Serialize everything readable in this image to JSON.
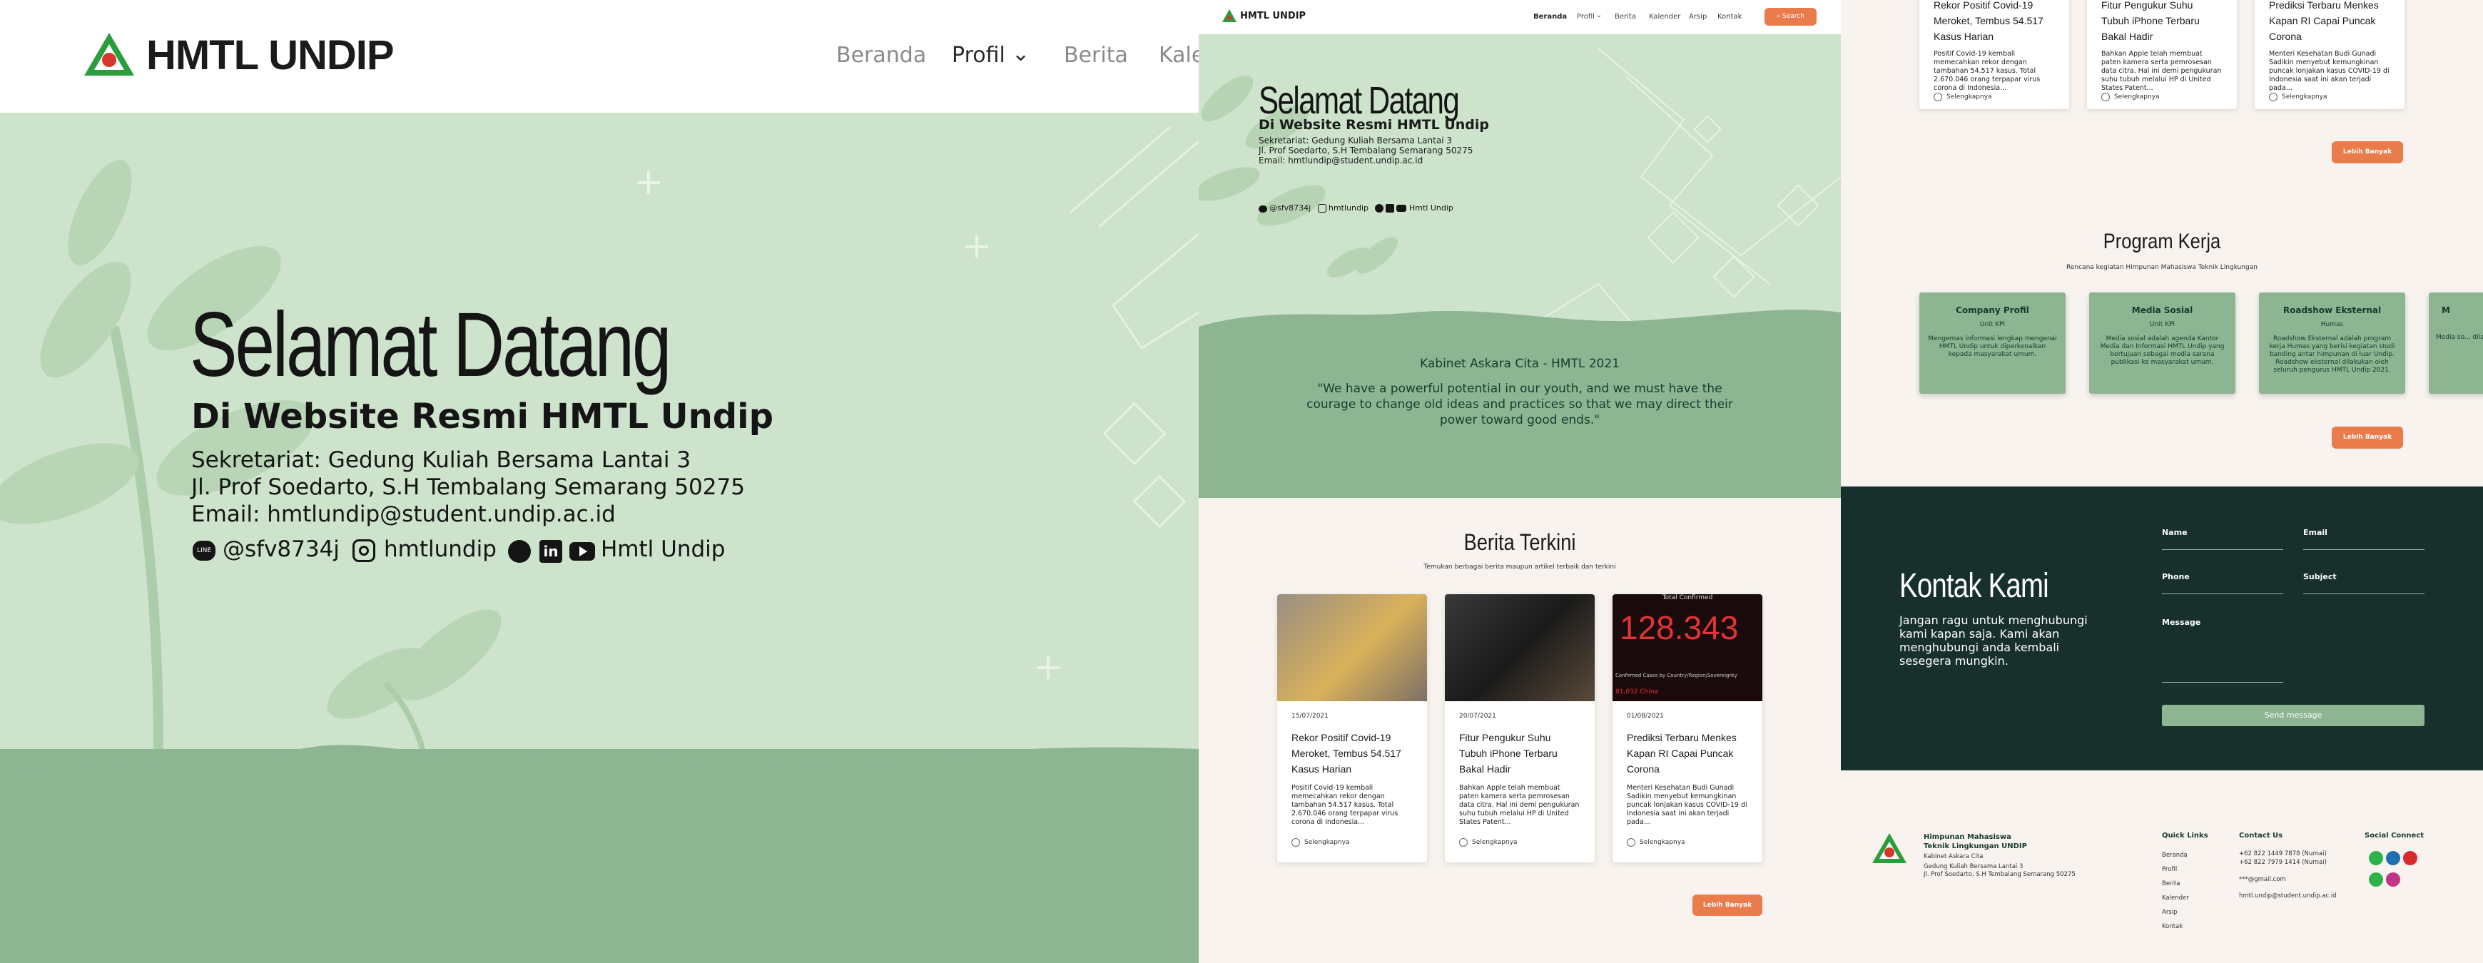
{
  "brand": {
    "name": "HMTL UNDIP"
  },
  "nav": {
    "items": [
      "Beranda",
      "Profil",
      "Berita",
      "Kalender",
      "Arsip",
      "Kontak"
    ],
    "search_label": "Search"
  },
  "hero": {
    "title": "Selamat Datang",
    "subtitle": "Di Website Resmi HMTL Undip",
    "address_1": "Sekretariat: Gedung Kuliah Bersama Lantai 3",
    "address_2": "Jl. Prof Soedarto, S.H Tembalang Semarang 50275",
    "email": "Email: hmtlundip@student.undip.ac.id",
    "line_id": "@sfv8734j",
    "instagram": "hmtlundip",
    "youtube": "Hmtl Undip"
  },
  "quote": {
    "cabinet": "Kabinet Askara Cita - HMTL 2021",
    "text": "\"We have a powerful potential in our youth, and we must have the courage to change old ideas and practices so that we may direct their power toward good ends.\""
  },
  "news": {
    "title": "Berita Terkini",
    "subtitle": "Temukan berbagai berita maupun artikel terbaik dan terkini",
    "read_more": "Selengkapnya",
    "more_button": "Lebih Banyak",
    "cards": [
      {
        "date": "15/07/2021",
        "title": "Rekor Positif Covid-19 Meroket, Tembus 54.517 Kasus Harian",
        "desc": "Positif Covid-19 kembali memecahkan rekor dengan tambahan 54.517 kasus. Total 2.670.046 orang terpapar virus corona di Indonesia..."
      },
      {
        "date": "20/07/2021",
        "title": "Fitur Pengukur Suhu Tubuh iPhone Terbaru Bakal Hadir",
        "desc": "Bahkan Apple telah membuat paten kamera serta pemrosesan data citra. Hal ini demi pengukuran suhu tubuh melalui HP di United States Patent..."
      },
      {
        "date": "01/08/2021",
        "title": "Prediksi Terbaru Menkes Kapan RI Capai Puncak Corona",
        "desc": "Menteri Kesehatan Budi Gunadi Sadikin menyebut kemungkinan puncak lonjakan kasus COVID-19 di Indonesia saat ini akan terjadi pada..."
      }
    ],
    "counter_value": "128.343",
    "counter_caption": "Confirmed Cases by Country/Region/Sovereignty",
    "counter_top": "Total Confirmed",
    "counter_bottom": "81,032 China"
  },
  "proker": {
    "title": "Program Kerja",
    "subtitle": "Rencana kegiatan Himpunan Mahasiswa Teknik Lingkungan",
    "more_button": "Lebih Banyak",
    "items": [
      {
        "title": "Company Profil",
        "unit": "Unit KPI",
        "desc": "Mengemas informasi lengkap mengenai HMTL Undip untuk diperkenalkan kepada masyarakat umum."
      },
      {
        "title": "Media Sosial",
        "unit": "Unit KPI",
        "desc": "Media sosial adalah agenda Kantor Media dan Informasi HMTL Undip yang bertujuan sebagai media sarana publikasi ke masyarakat umum."
      },
      {
        "title": "Roadshow Eksternal",
        "unit": "Humas",
        "desc": "Roadshow Eksternal adalah program kerja Humas yang berisi kegiatan studi banding antar himpunan di luar Undip. Roadshow eksternal dilakukan oleh seluruh pengurus HMTL Undip 2021."
      },
      {
        "title": "M",
        "unit": "",
        "desc": "Media so... dilakukan... bersosia..."
      }
    ]
  },
  "contact": {
    "title": "Kontak Kami",
    "desc": "Jangan ragu untuk menghubungi kami kapan saja. Kami akan menghubungi anda kembali sesegera mungkin.",
    "name_label": "Name",
    "email_label": "Email",
    "phone_label": "Phone",
    "subject_label": "Subject",
    "message_label": "Message",
    "send_label": "Send message"
  },
  "footer": {
    "org_1": "Himpunan Mahasiswa",
    "org_2": "Teknik Lingkungan UNDIP",
    "cabinet": "Kabinet Askara Cita",
    "addr_1": "Gedung Kuliah Bersama Lantai 3",
    "addr_2": "Jl. Prof Soedarto, S.H Tembalang Semarang 50275",
    "quick_links_title": "Quick Links",
    "quick_links": [
      "Beranda",
      "Profil",
      "Berita",
      "Kalender",
      "Arsip",
      "Kontak"
    ],
    "contact_title": "Contact Us",
    "phone_1": "+62 822 1449 7878 (Nurnai)",
    "phone_2": "+62 822 7979 1414 (Nurnai)",
    "mail_1": "***@gmail.com",
    "mail_2": "hmtl.undip@student.undip.ac.id",
    "social_title": "Social Connect"
  },
  "colors": {
    "sage": "#8db592",
    "mint": "#cde3cb",
    "orange": "#ea7b4b",
    "dark": "#17302c"
  }
}
